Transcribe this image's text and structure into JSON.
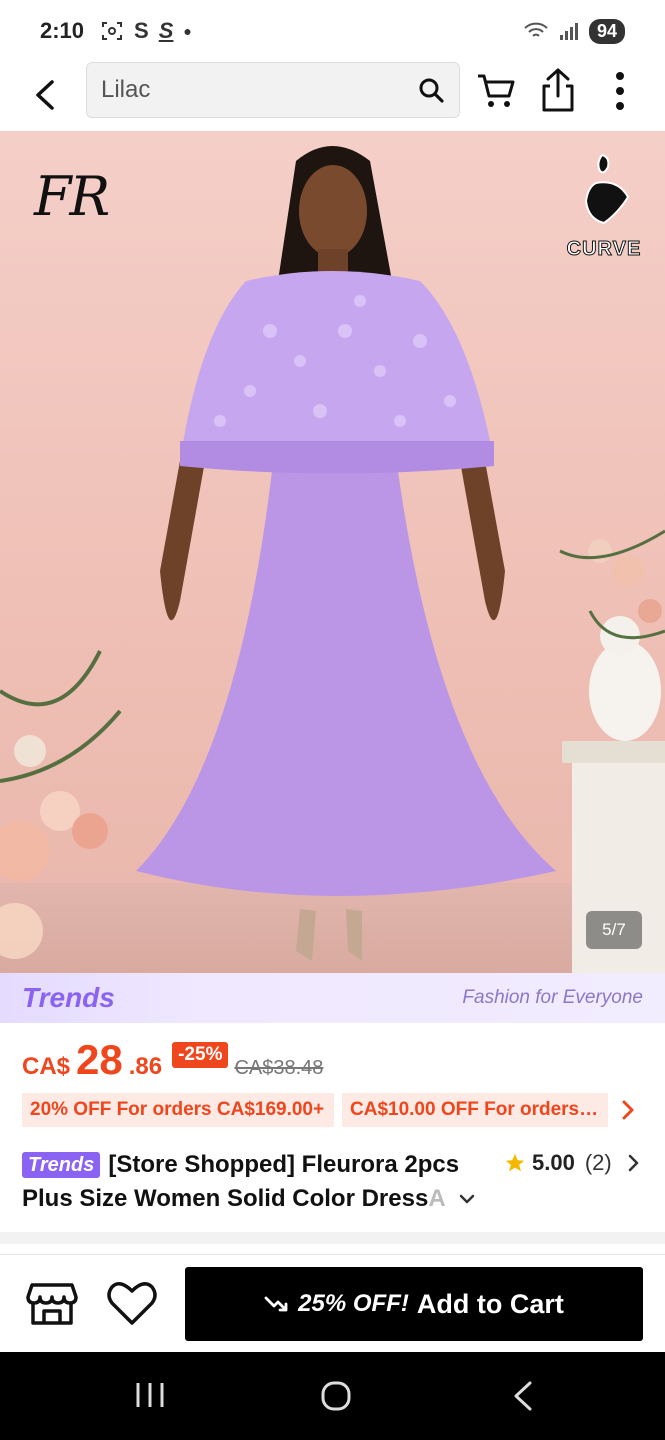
{
  "status_bar": {
    "time": "2:10",
    "battery": "94",
    "icons": [
      "screenshot-icon",
      "s-icon",
      "s-strike-icon",
      "dot-icon",
      "wifi-icon",
      "signal-icon"
    ]
  },
  "top_bar": {
    "search_value": "Lilac"
  },
  "hero": {
    "brand_logo": "FR",
    "badge_label": "CURVE",
    "page_indicator": "5/7"
  },
  "trends_banner": {
    "logo": "Trends",
    "tagline": "Fashion for Everyone"
  },
  "price": {
    "currency": "CA$",
    "integer": "28",
    "decimal": ".86",
    "discount": "-25%",
    "original": "CA$38.48"
  },
  "promos": [
    {
      "label": "20% OFF For orders CA$169.00+"
    },
    {
      "label": "CA$10.00 OFF For orders ..."
    }
  ],
  "product": {
    "tag": "Trends",
    "title_line1": "[Store Shopped] Fleurora 2pcs",
    "title_line2": "Plus Size Women Solid Color Dress",
    "title_fade": " A",
    "rating": "5.00",
    "rating_count": "(2)"
  },
  "action_bar": {
    "promo": "25% OFF!",
    "add_to_cart": "Add to Cart"
  },
  "colors": {
    "accent": "#f0461e",
    "trends": "#8b63f2",
    "dress": "#bb96e6",
    "star": "#f5b800"
  }
}
